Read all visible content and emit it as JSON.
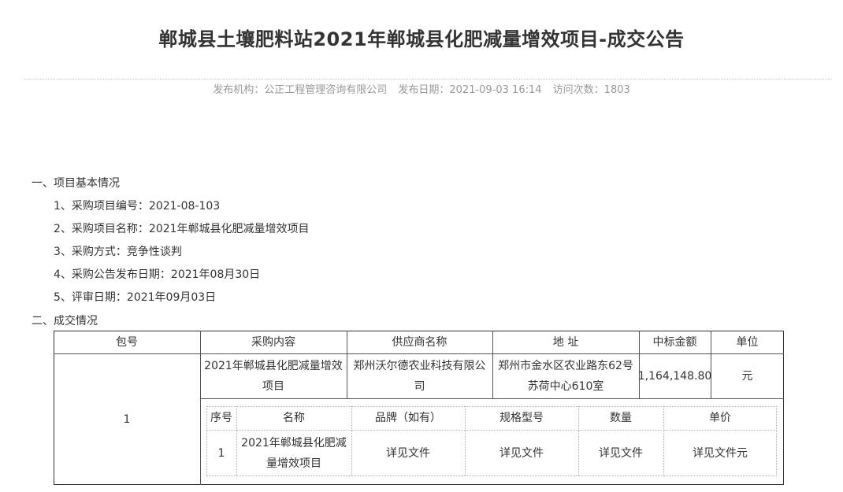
{
  "title": "郸城县土壤肥料站2021年郸城县化肥减量增效项目-成交公告",
  "meta": {
    "publisher": "发布机构：公正工程管理咨询有限公司",
    "date": "发布日期：2021-09-03 16:14",
    "visits": "访问次数：1803"
  },
  "sections": {
    "basic": "一、项目基本情况",
    "deal": "二、成交情况"
  },
  "basic_info": [
    "1、采购项目编号：2021-08-103",
    "2、采购项目名称：2021年郸城县化肥减量增效项目",
    "3、采购方式：竞争性谈判",
    "4、采购公告发布日期：2021年08月30日",
    "5、评审日期：2021年09月03日"
  ],
  "deal_table": {
    "headers": [
      "包号",
      "采购内容",
      "供应商名称",
      "地 址",
      "中标金额",
      "单位"
    ],
    "row": {
      "package": "1",
      "content_line1": "2021年郸城县化肥减量增效",
      "content_line2": "项目",
      "supplier_line1": "郑州沃尔德农业科技有限公",
      "supplier_line2": "司",
      "address_line1": "郑州市金水区农业路东62号",
      "address_line2": "苏荷中心610室",
      "amount": "1,164,148.80",
      "unit": "元"
    },
    "detail": {
      "headers": [
        "序号",
        "名称",
        "品牌（如有）",
        "规格型号",
        "数量",
        "单价"
      ],
      "row": {
        "index": "1",
        "name_line1": "2021年郸城县化肥减",
        "name_line2": "量增效项目",
        "brand": "详见文件",
        "spec": "详见文件",
        "quantity": "详见文件",
        "price": "详见文件元"
      }
    }
  }
}
